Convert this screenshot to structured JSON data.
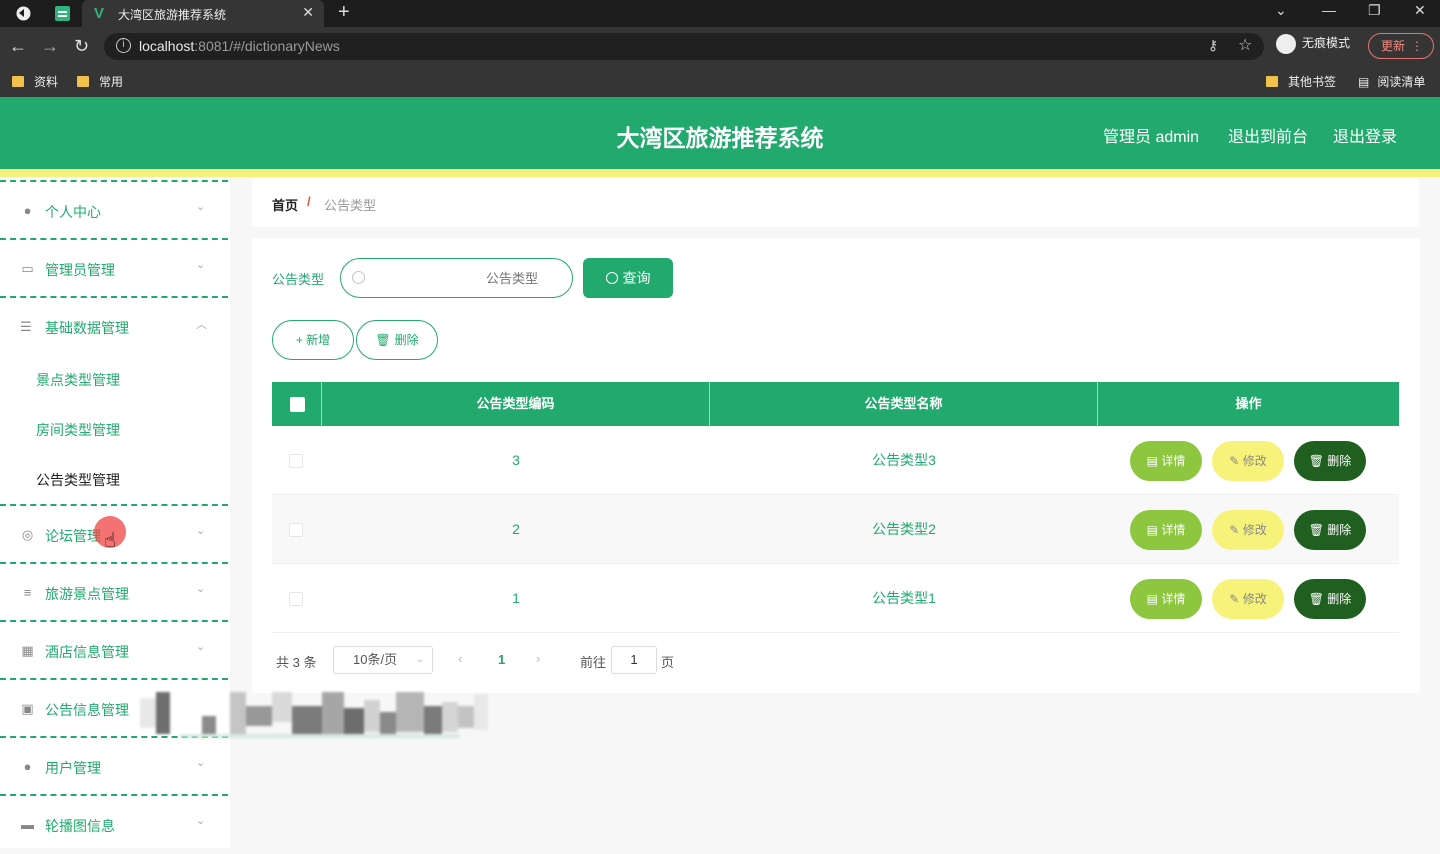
{
  "browser": {
    "tab_title": "大湾区旅游推荐系统",
    "url_host": "localhost",
    "url_rest": ":8081/#/dictionaryNews",
    "incognito_label": "无痕模式",
    "update_label": "更新",
    "bookmarks_left": [
      "资料",
      "常用"
    ],
    "bookmarks_right": [
      "其他书签",
      "阅读清单"
    ]
  },
  "header": {
    "title": "大湾区旅游推荐系统",
    "admin_label": "管理员 admin",
    "to_front_label": "退出到前台",
    "logout_label": "退出登录",
    "color": "#22aa6e",
    "accent_line": "#f4f27a"
  },
  "sidebar": {
    "items": [
      {
        "label": "个人中心",
        "icon": "user-icon"
      },
      {
        "label": "管理员管理",
        "icon": "card-icon"
      },
      {
        "label": "基础数据管理",
        "icon": "sliders-icon",
        "expanded": true
      },
      {
        "label": "论坛管理",
        "icon": "compass-icon"
      },
      {
        "label": "旅游景点管理",
        "icon": "list-icon"
      },
      {
        "label": "酒店信息管理",
        "icon": "grid-icon"
      },
      {
        "label": "公告信息管理",
        "icon": "chart-icon"
      },
      {
        "label": "用户管理",
        "icon": "person-icon"
      },
      {
        "label": "轮播图信息",
        "icon": "suitcase-icon"
      }
    ],
    "sub_items": [
      {
        "label": "景点类型管理"
      },
      {
        "label": "房间类型管理"
      },
      {
        "label": "公告类型管理",
        "active": true
      }
    ]
  },
  "breadcrumb": {
    "home": "首页",
    "separator": "/",
    "current": "公告类型"
  },
  "search": {
    "label": "公告类型",
    "placeholder": "公告类型",
    "query_label": "查询"
  },
  "toolbar": {
    "add_label": "+ 新增",
    "delete_label": "删除"
  },
  "table": {
    "headers": [
      "公告类型编码",
      "公告类型名称",
      "操作"
    ],
    "rows": [
      {
        "code": "3",
        "name": "公告类型3"
      },
      {
        "code": "2",
        "name": "公告类型2"
      },
      {
        "code": "1",
        "name": "公告类型1"
      }
    ],
    "actions": {
      "detail": "详情",
      "edit": "修改",
      "delete": "删除"
    }
  },
  "pagination": {
    "total": "共 3 条",
    "page_size": "10条/页",
    "current_page": "1",
    "goto_label": "前往",
    "goto_value": "1",
    "page_unit": "页"
  }
}
